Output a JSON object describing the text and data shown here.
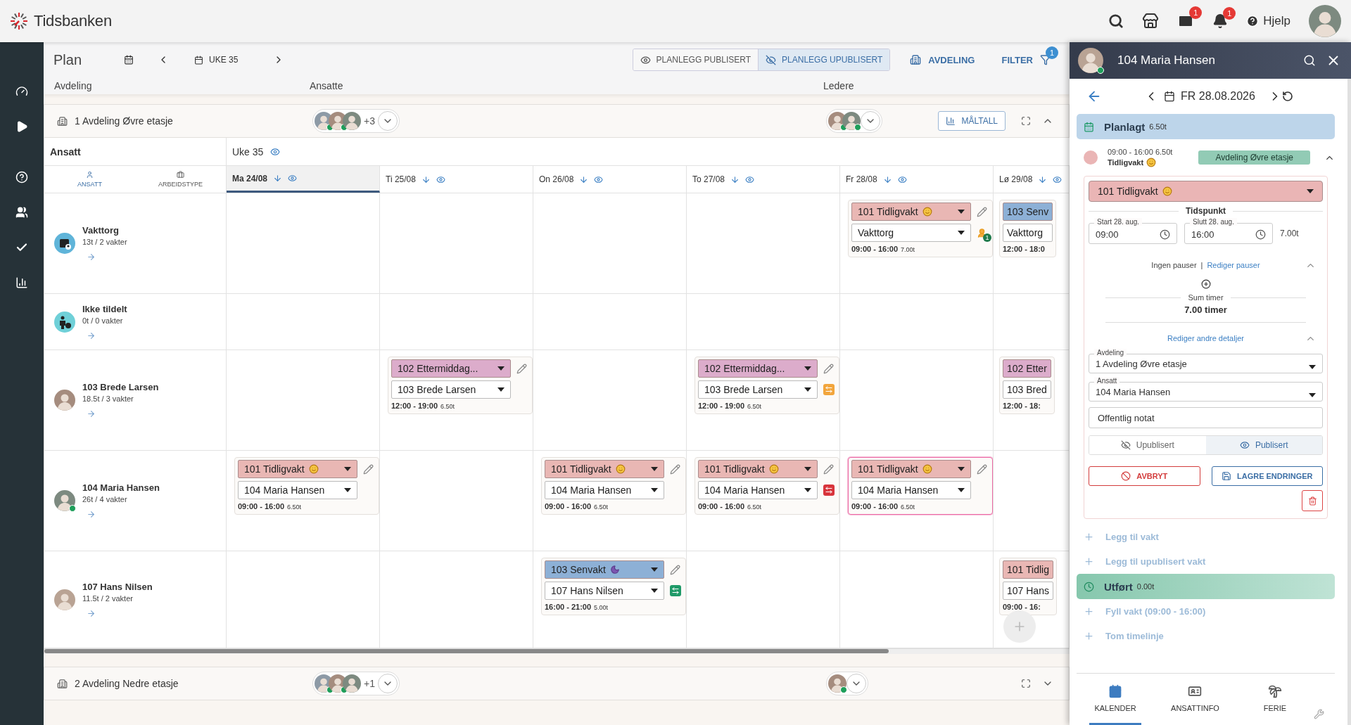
{
  "header": {
    "logo": "Tidsbanken",
    "mail_badge": "1",
    "notification_badge": "1",
    "help": "Hjelp"
  },
  "toolbar": {
    "title": "Plan",
    "week": "UKE 35",
    "view_modes": [
      {
        "label": "PLANLEGG PUBLISERT",
        "selected": false
      },
      {
        "label": "PLANLEGG UPUBLISERT",
        "selected": true
      }
    ],
    "department": "AVDELING",
    "filter": "FILTER",
    "filter_badge": "1"
  },
  "section_labels": [
    "Avdeling",
    "Ansatte",
    "Ledere"
  ],
  "departments": [
    {
      "name": "1 Avdeling Øvre etasje",
      "employees": [
        {
          "online": true
        },
        {
          "online": true
        },
        {
          "online": false
        }
      ],
      "more": "+3",
      "leaders": [
        {
          "online": true
        },
        {
          "online": true
        }
      ],
      "metrics": "MÅLTALL",
      "expanded": true,
      "grid": {
        "employee_heading": "Ansatt",
        "week_label": "Uke 35",
        "sort_tabs": [
          {
            "label": "ANSATT",
            "selected": true
          },
          {
            "label": "ARBEIDSTYPE",
            "selected": false
          }
        ],
        "days": [
          {
            "label": "Ma 24/08",
            "selected": true
          },
          {
            "label": "Ti 25/08",
            "selected": false
          },
          {
            "label": "On 26/08",
            "selected": false
          },
          {
            "label": "To 27/08",
            "selected": false
          },
          {
            "label": "Fr 28/08",
            "selected": false
          },
          {
            "label": "Lø 29/08",
            "selected": false
          }
        ],
        "rows": [
          {
            "kind": "market",
            "name": "Vakttorg",
            "summary": "13t / 2 vakter",
            "cells": [
              {
                "kind": "empty"
              },
              {
                "kind": "empty"
              },
              {
                "kind": "empty"
              },
              {
                "kind": "empty"
              },
              {
                "kind": "shift",
                "type": "101 Tidligvakt",
                "icon": {
                  "kind": "smile"
                },
                "color": "#e9b7b4",
                "assignee": "Vakttorg",
                "time": "09:00 - 16:00",
                "hours": "7.00t",
                "selected": false,
                "partial": false,
                "status": {
                  "kind": "market",
                  "count": "1"
                }
              },
              {
                "kind": "shift",
                "type": "103 Senv",
                "color": "#8db0d6",
                "assignee": "Vakttorg",
                "time": "12:00 - 18:0",
                "selected": false,
                "partial": true
              }
            ]
          },
          {
            "kind": "unassigned",
            "name": "Ikke tildelt",
            "summary": "0t / 0 vakter",
            "cells": [
              {
                "kind": "empty"
              },
              {
                "kind": "empty"
              },
              {
                "kind": "empty"
              },
              {
                "kind": "empty"
              },
              {
                "kind": "empty"
              },
              {
                "kind": "empty"
              }
            ]
          },
          {
            "kind": "person",
            "name": "103 Brede Larsen",
            "summary": "18.5t / 3 vakter",
            "online": false,
            "cells": [
              {
                "kind": "empty"
              },
              {
                "kind": "shift",
                "type": "102 Ettermiddag...",
                "color": "#dcaccb",
                "assignee": "103 Brede Larsen",
                "time": "12:00 - 19:00",
                "hours": "6.50t",
                "selected": false,
                "partial": false
              },
              {
                "kind": "empty"
              },
              {
                "kind": "shift",
                "type": "102 Ettermiddag...",
                "color": "#dcaccb",
                "assignee": "103 Brede Larsen",
                "time": "12:00 - 19:00",
                "hours": "6.50t",
                "selected": false,
                "partial": false,
                "status": {
                  "kind": "swap",
                  "color": "#f2a53c"
                }
              },
              {
                "kind": "empty"
              },
              {
                "kind": "shift",
                "type": "102 Etter",
                "color": "#dcaccb",
                "assignee": "103 Bred",
                "time": "12:00 - 18:",
                "selected": false,
                "partial": true
              }
            ]
          },
          {
            "kind": "person",
            "name": "104 Maria Hansen",
            "summary": "26t / 4 vakter",
            "online": true,
            "cells": [
              {
                "kind": "shift",
                "type": "101 Tidligvakt",
                "icon": {
                  "kind": "smile"
                },
                "color": "#e9b7b4",
                "assignee": "104 Maria Hansen",
                "time": "09:00 - 16:00",
                "hours": "6.50t",
                "selected": false,
                "partial": false
              },
              {
                "kind": "empty"
              },
              {
                "kind": "shift",
                "type": "101 Tidligvakt",
                "icon": {
                  "kind": "smile"
                },
                "color": "#e9b7b4",
                "assignee": "104 Maria Hansen",
                "time": "09:00 - 16:00",
                "hours": "6.50t",
                "selected": false,
                "partial": false
              },
              {
                "kind": "shift",
                "type": "101 Tidligvakt",
                "icon": {
                  "kind": "smile"
                },
                "color": "#e9b7b4",
                "assignee": "104 Maria Hansen",
                "time": "09:00 - 16:00",
                "hours": "6.50t",
                "selected": false,
                "partial": false,
                "status": {
                  "kind": "swap",
                  "color": "#d8343c"
                }
              },
              {
                "kind": "shift",
                "type": "101 Tidligvakt",
                "icon": {
                  "kind": "smile"
                },
                "color": "#e9b7b4",
                "assignee": "104 Maria Hansen",
                "time": "09:00 - 16:00",
                "hours": "6.50t",
                "selected": true,
                "partial": false
              },
              {
                "kind": "empty"
              }
            ]
          },
          {
            "kind": "person",
            "name": "107 Hans Nilsen",
            "summary": "11.5t / 2 vakter",
            "online": false,
            "cells": [
              {
                "kind": "empty"
              },
              {
                "kind": "empty"
              },
              {
                "kind": "shift",
                "type": "103 Senvakt",
                "icon": {
                  "kind": "moon"
                },
                "color": "#8db0d6",
                "assignee": "107 Hans Nilsen",
                "time": "16:00 - 21:00",
                "hours": "5.00t",
                "selected": false,
                "partial": false,
                "status": {
                  "kind": "swap",
                  "color": "#1f9a68"
                }
              },
              {
                "kind": "empty"
              },
              {
                "kind": "empty"
              },
              {
                "kind": "shift",
                "type": "101 Tidlig",
                "color": "#e9b7b4",
                "assignee": "107 Hans",
                "time": "09:00 - 16:",
                "selected": false,
                "partial": true,
                "add_button": true
              }
            ]
          }
        ]
      }
    },
    {
      "name": "2 Avdeling Nedre etasje",
      "employees": [
        {
          "online": true
        },
        {
          "online": true
        },
        {
          "online": false
        }
      ],
      "more": "+1",
      "leaders": [
        {
          "online": true
        }
      ],
      "expanded": false
    }
  ],
  "panel": {
    "title": "104 Maria Hansen",
    "online": true,
    "date": "FR 28.08.2026",
    "planned": {
      "label": "Planlagt",
      "hours": "6.50t"
    },
    "shift": {
      "time": "09:00 - 16:00 6.50t",
      "name": "Tidligvakt",
      "icon": {
        "kind": "smile"
      },
      "color": "#eab5b5",
      "department": "Avdeling Øvre etasje",
      "expanded": true,
      "type": "101 Tidligvakt",
      "section": "Tidspunkt",
      "start": {
        "label": "Start 28. aug.",
        "value": "09:00"
      },
      "end": {
        "label": "Slutt 28. aug.",
        "value": "16:00"
      },
      "duration": "7.00t",
      "breaks": "Ingen pauser",
      "breaks_separator": "|",
      "edit_breaks": "Rediger pauser",
      "breaks_expanded": true,
      "sum_label": "Sum timer",
      "sum": "7.00 timer",
      "edit_details": "Rediger andre detaljer",
      "details_expanded": true,
      "department_field": {
        "label": "Avdeling",
        "value": "1 Avdeling Øvre etasje"
      },
      "employee_field": {
        "label": "Ansatt",
        "value": "104 Maria Hansen"
      },
      "note_placeholder": "Offentlig notat",
      "publish_options": [
        {
          "label": "Upublisert",
          "selected": false
        },
        {
          "label": "Publisert",
          "selected": true
        }
      ],
      "cancel": "AVBRYT",
      "save": "LAGRE ENDRINGER"
    },
    "actions": [
      "Legg til vakt",
      "Legg til upublisert vakt"
    ],
    "done": {
      "label": "Utført",
      "hours": "0.00t"
    },
    "done_actions": [
      "Fyll vakt (09:00 - 16:00)",
      "Tom timelinje"
    ],
    "tabs": [
      {
        "label": "KALENDER",
        "kind": "calendar",
        "selected": true
      },
      {
        "label": "ANSATTINFO",
        "kind": "card",
        "selected": false
      },
      {
        "label": "FERIE",
        "kind": "palm",
        "selected": false
      }
    ]
  }
}
